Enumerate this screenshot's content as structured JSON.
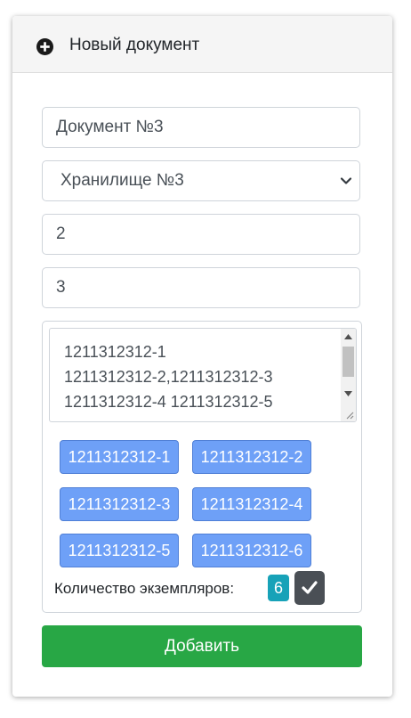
{
  "header": {
    "title": "Новый документ",
    "icon": "plus-circle-icon"
  },
  "form": {
    "document_name": "Документ №3",
    "storage_selected": "Хранилище №3",
    "field_two": "2",
    "field_three": "3",
    "codes_text": "1211312312-1\n1211312312-2,1211312312-3\n1211312312-4 1211312312-5",
    "chips": [
      "1211312312-1",
      "1211312312-2",
      "1211312312-3",
      "1211312312-4",
      "1211312312-5",
      "1211312312-6"
    ],
    "count_label": "Количество экземпляров:",
    "count_value": "6",
    "submit_label": "Добавить"
  },
  "colors": {
    "chip": "#6ea0f7",
    "badge": "#17a2b8",
    "submit": "#28a745",
    "confirm": "#4a4f55"
  }
}
